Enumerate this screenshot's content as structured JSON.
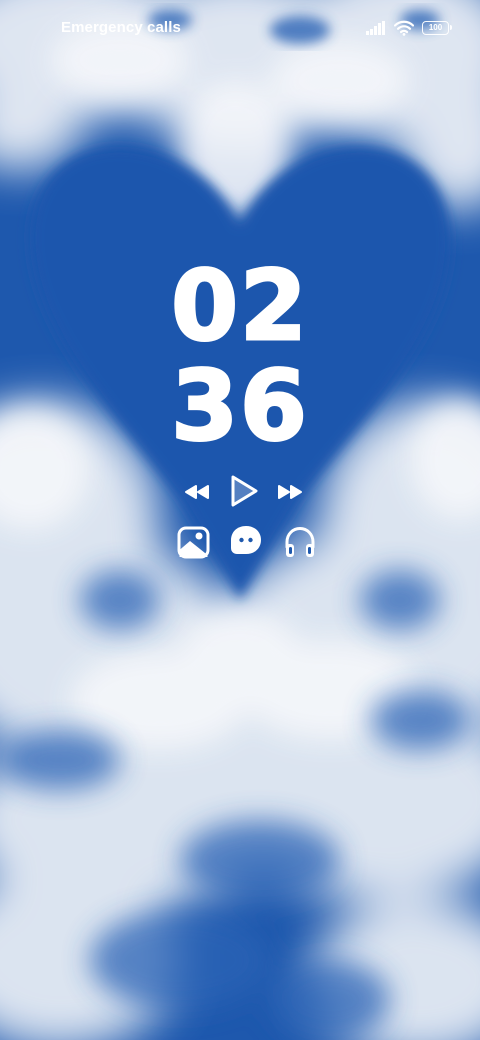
{
  "status_bar": {
    "carrier_text": "Emergency calls",
    "battery_level": "100",
    "icons": [
      "signal-icon",
      "wifi-icon",
      "battery-icon"
    ]
  },
  "clock": {
    "hours": "02",
    "minutes": "36"
  },
  "media_controls": {
    "icons": [
      "previous-icon",
      "play-icon",
      "next-icon"
    ]
  },
  "shortcuts": {
    "icons": [
      "gallery-icon",
      "chat-icon",
      "headphones-icon"
    ]
  },
  "colors": {
    "sky": "#1e58ad",
    "cloud": "#ffffff",
    "text": "#ffffff"
  }
}
